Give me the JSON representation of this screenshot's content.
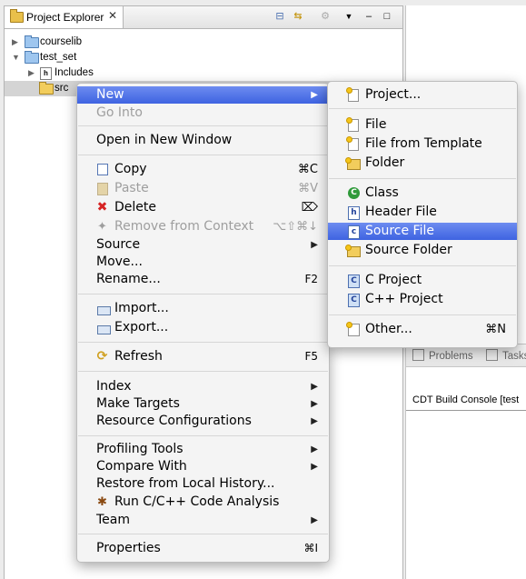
{
  "explorer": {
    "title": "Project Explorer",
    "tree": [
      {
        "label": "courselib",
        "expanded": false
      },
      {
        "label": "test_set",
        "expanded": true
      },
      {
        "label": "Includes",
        "expanded": false
      },
      {
        "label": "src",
        "selected": true
      }
    ]
  },
  "bottom_pane": {
    "tab_problems": "Problems",
    "tab_tasks": "Tasks",
    "console_title": "CDT Build Console [test"
  },
  "context_menu": {
    "items": [
      {
        "label": "New",
        "submenu": true,
        "highlighted": true
      },
      {
        "label": "Go Into",
        "disabled": true
      },
      {
        "label": "Open in New Window"
      },
      {
        "label": "Copy",
        "shortcut": "⌘C",
        "icon": "copy-icon"
      },
      {
        "label": "Paste",
        "shortcut": "⌘V",
        "icon": "paste-icon",
        "disabled": true
      },
      {
        "label": "Delete",
        "shortcut": "⌦",
        "icon": "delete-icon"
      },
      {
        "label": "Remove from Context",
        "shortcut": "⌥⇧⌘↓",
        "icon": "remove-context-icon",
        "disabled": true
      },
      {
        "label": "Source",
        "submenu": true
      },
      {
        "label": "Move..."
      },
      {
        "label": "Rename...",
        "shortcut": "F2"
      },
      {
        "label": "Import...",
        "icon": "import-icon"
      },
      {
        "label": "Export...",
        "icon": "export-icon"
      },
      {
        "label": "Refresh",
        "shortcut": "F5",
        "icon": "refresh-icon"
      },
      {
        "label": "Index",
        "submenu": true
      },
      {
        "label": "Make Targets",
        "submenu": true
      },
      {
        "label": "Resource Configurations",
        "submenu": true
      },
      {
        "label": "Profiling Tools",
        "submenu": true
      },
      {
        "label": "Compare With",
        "submenu": true
      },
      {
        "label": "Restore from Local History..."
      },
      {
        "label": "Run C/C++ Code Analysis",
        "icon": "code-analysis-icon"
      },
      {
        "label": "Team",
        "submenu": true
      },
      {
        "label": "Properties",
        "shortcut": "⌘I"
      }
    ]
  },
  "new_submenu": {
    "items": [
      {
        "label": "Project...",
        "icon": "new-project-icon"
      },
      {
        "label": "File",
        "icon": "file-icon"
      },
      {
        "label": "File from Template",
        "icon": "file-template-icon"
      },
      {
        "label": "Folder",
        "icon": "folder-icon"
      },
      {
        "label": "Class",
        "icon": "class-icon"
      },
      {
        "label": "Header File",
        "icon": "header-file-icon"
      },
      {
        "label": "Source File",
        "icon": "source-file-icon",
        "highlighted": true
      },
      {
        "label": "Source Folder",
        "icon": "source-folder-icon"
      },
      {
        "label": "C Project",
        "icon": "c-project-icon"
      },
      {
        "label": "C++ Project",
        "icon": "cpp-project-icon"
      },
      {
        "label": "Other...",
        "shortcut": "⌘N",
        "icon": "other-wizard-icon"
      }
    ]
  },
  "colors": {
    "highlight": "#3e63e1",
    "selection": "#d4d4d4",
    "disabled_text": "#9e9e9e",
    "delete_icon": "#d62424"
  }
}
